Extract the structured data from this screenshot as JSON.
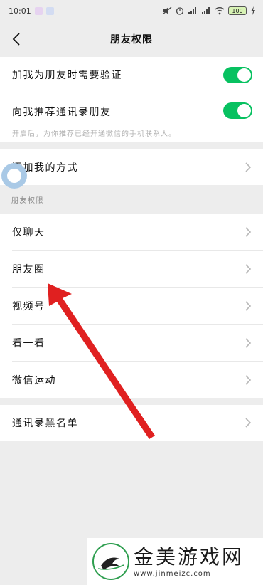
{
  "status_bar": {
    "time": "10:01",
    "battery": "100"
  },
  "nav": {
    "title": "朋友权限"
  },
  "verify_row": {
    "label": "加我为朋友时需要验证",
    "enabled": true
  },
  "recommend_row": {
    "label": "向我推荐通讯录朋友",
    "hint": "开启后，为你推荐已经开通微信的手机联系人。",
    "enabled": true
  },
  "add_me_row": {
    "label": "添加我的方式"
  },
  "section_header": "朋友权限",
  "permissions": [
    {
      "label": "仅聊天"
    },
    {
      "label": "朋友圈"
    },
    {
      "label": "视频号"
    },
    {
      "label": "看一看"
    },
    {
      "label": "微信运动"
    }
  ],
  "blacklist_row": {
    "label": "通讯录黑名单"
  },
  "watermark": {
    "brand": "金美游戏网",
    "url": "www.jinmeizc.com"
  },
  "colors": {
    "toggle_on": "#07c160",
    "annotation_arrow": "#e02020"
  }
}
